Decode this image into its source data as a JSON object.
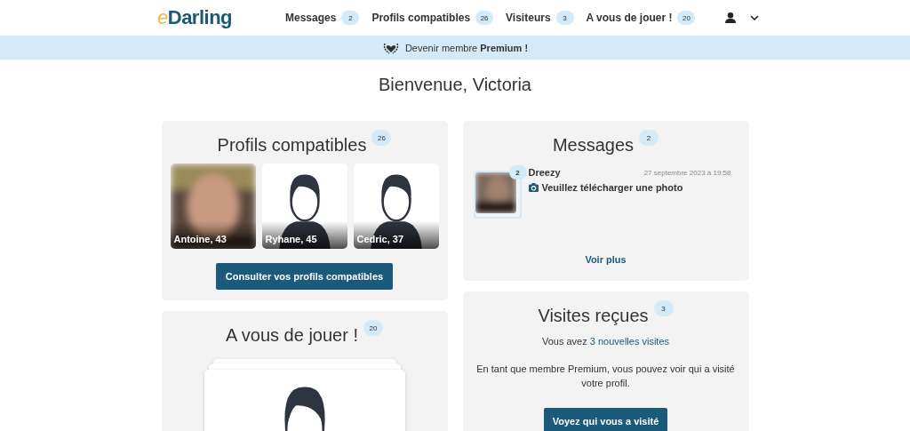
{
  "header": {
    "logo": {
      "prefix": "e",
      "name": "Darling"
    },
    "nav": [
      {
        "label": "Messages",
        "count": "2"
      },
      {
        "label": "Profils compatibles",
        "count": "26"
      },
      {
        "label": "Visiteurs",
        "count": "3"
      },
      {
        "label": "A vous de jouer !",
        "count": "20"
      }
    ]
  },
  "banner": {
    "text": "Devenir membre **Premium !**"
  },
  "welcome": "Bienvenue, Victoria",
  "compatible": {
    "title": "Profils compatibles",
    "count": "26",
    "profiles": [
      {
        "name": "Antoine, 43"
      },
      {
        "name": "Ryhane, 45",
        "kind": "avatar"
      },
      {
        "name": "Cedric, 37",
        "kind": "avatar"
      }
    ],
    "button": "Consulter vos profils compatibles"
  },
  "play": {
    "title": "A vous de jouer !",
    "count": "20"
  },
  "messages": {
    "title": "Messages",
    "count": "2",
    "items": [
      {
        "sender": "Dreezy",
        "date": "27 septembre 2023 à 19:58",
        "unread": "2",
        "preview": "Veuillez télécharger une photo"
      }
    ],
    "more": "Voir plus"
  },
  "visits": {
    "title": "Visites reçues",
    "count": "3",
    "summary": "Vous avez ",
    "link": "3 nouvelles visites",
    "text": "En tant que membre Premium, vous pouvez voir qui a visité votre profil.",
    "button": "Voyez qui vous a visité"
  }
}
